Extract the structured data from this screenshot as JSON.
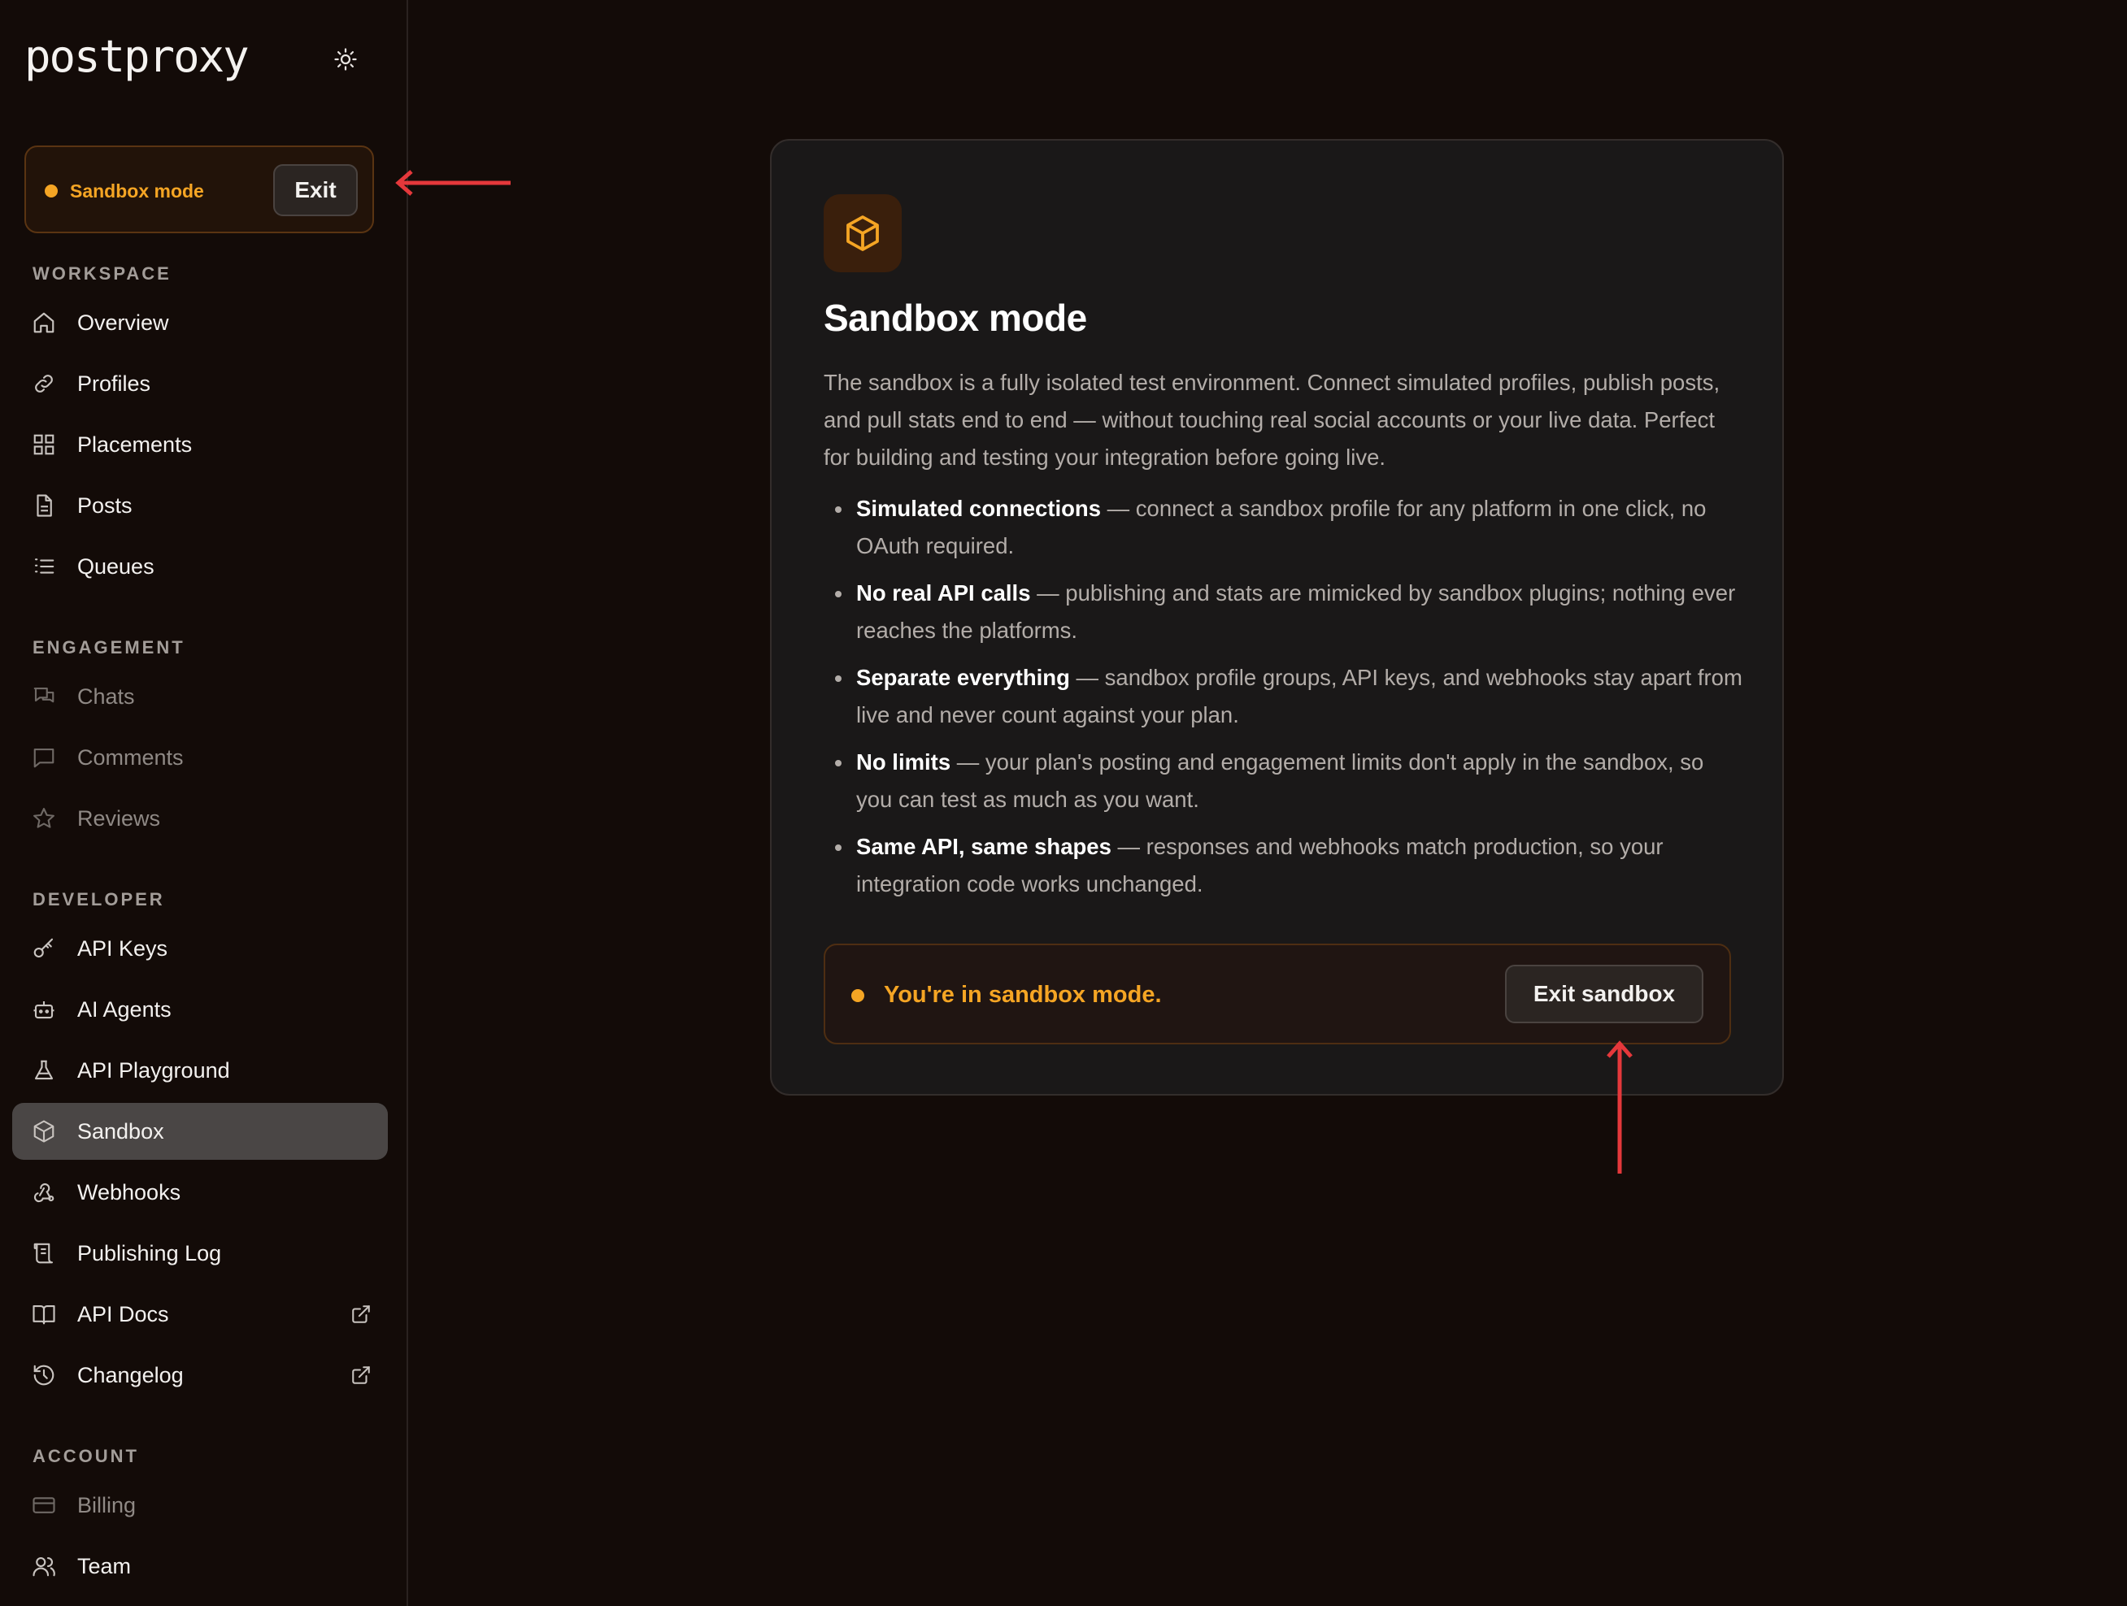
{
  "app": {
    "logo_text": "postproxy"
  },
  "sandbox_pill": {
    "label": "Sandbox mode",
    "exit_label": "Exit"
  },
  "sidebar": {
    "sections": [
      {
        "title": "WORKSPACE",
        "items": [
          {
            "label": "Overview",
            "icon": "home-icon"
          },
          {
            "label": "Profiles",
            "icon": "link-icon"
          },
          {
            "label": "Placements",
            "icon": "grid-icon"
          },
          {
            "label": "Posts",
            "icon": "document-icon"
          },
          {
            "label": "Queues",
            "icon": "list-icon"
          }
        ]
      },
      {
        "title": "ENGAGEMENT",
        "items": [
          {
            "label": "Chats",
            "icon": "chats-icon"
          },
          {
            "label": "Comments",
            "icon": "comment-icon"
          },
          {
            "label": "Reviews",
            "icon": "star-icon"
          }
        ]
      },
      {
        "title": "DEVELOPER",
        "items": [
          {
            "label": "API Keys",
            "icon": "key-icon"
          },
          {
            "label": "AI Agents",
            "icon": "robot-icon"
          },
          {
            "label": "API Playground",
            "icon": "flask-icon"
          },
          {
            "label": "Sandbox",
            "icon": "cube-icon",
            "active": true
          },
          {
            "label": "Webhooks",
            "icon": "webhook-icon"
          },
          {
            "label": "Publishing Log",
            "icon": "scroll-icon"
          },
          {
            "label": "API Docs",
            "icon": "book-icon",
            "external": true
          },
          {
            "label": "Changelog",
            "icon": "history-icon",
            "external": true
          }
        ]
      },
      {
        "title": "ACCOUNT",
        "items": [
          {
            "label": "Billing",
            "icon": "credit-card-icon"
          },
          {
            "label": "Team",
            "icon": "users-icon"
          }
        ]
      }
    ]
  },
  "card": {
    "icon": "cube-icon",
    "title": "Sandbox mode",
    "description": "The sandbox is a fully isolated test environment. Connect simulated profiles, publish posts, and pull stats end to end — without touching real social accounts or your live data. Perfect for building and testing your integration before going live.",
    "features": [
      {
        "title": "Simulated connections",
        "text": " — connect a sandbox profile for any platform in one click, no OAuth required."
      },
      {
        "title": "No real API calls",
        "text": " — publishing and stats are mimicked by sandbox plugins; nothing ever reaches the platforms."
      },
      {
        "title": "Separate everything",
        "text": " — sandbox profile groups, API keys, and webhooks stay apart from live and never count against your plan."
      },
      {
        "title": "No limits",
        "text": " — your plan's posting and engagement limits don't apply in the sandbox, so you can test as much as you want."
      },
      {
        "title": "Same API, same shapes",
        "text": " — responses and webhooks match production, so your integration code works unchanged."
      }
    ],
    "status_text": "You're in sandbox mode.",
    "exit_button_label": "Exit sandbox"
  },
  "colors": {
    "background": "#130b08",
    "accent": "#f5a524",
    "annotation_arrow": "#e5383b"
  }
}
